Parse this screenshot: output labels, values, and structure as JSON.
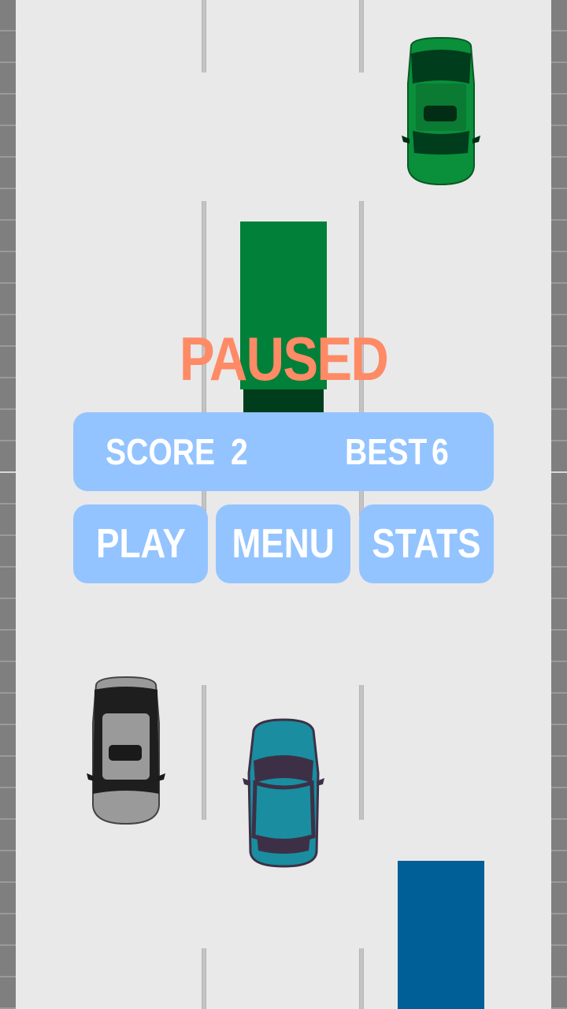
{
  "overlay": {
    "title": "PAUSED",
    "score_label": "SCORE",
    "score_value": "2",
    "best_label": "BEST",
    "best_value": "6"
  },
  "buttons": {
    "play": "PLAY",
    "menu": "MENU",
    "stats": "STATS"
  },
  "colors": {
    "road": "#e9e9e9",
    "panel": "#93c4ff",
    "title": "#ff8a66",
    "green_car": "#0a8f3a",
    "gray_car": "#9a9a9a",
    "teal_car": "#1a8da0",
    "green_truck": "#008039",
    "blue_truck": "#005f96"
  }
}
